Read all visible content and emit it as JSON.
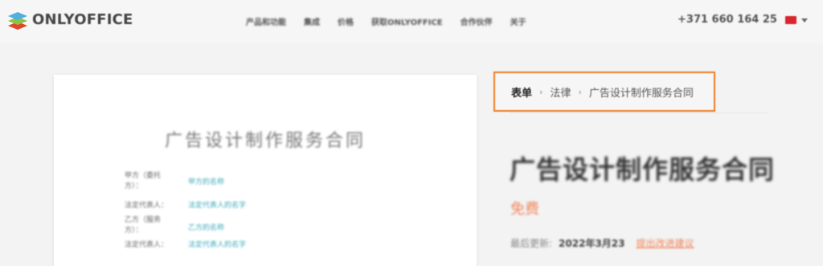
{
  "header": {
    "logo_text": "ONLYOFFICE",
    "nav": [
      "产品和功能",
      "集成",
      "价格",
      "获取ONLYOFFICE",
      "合作伙伴",
      "关于"
    ],
    "phone": "+371 660 164 25",
    "language_flag": "cn-flag-icon"
  },
  "preview": {
    "doc_title": "广告设计制作服务合同",
    "fields": [
      {
        "label": "甲方（委托方）：",
        "value": "甲方的名称"
      },
      {
        "label": "法定代表人：",
        "value": "法定代表人的名字"
      },
      {
        "label": "乙方（服务方）：",
        "value": "乙方的名称"
      },
      {
        "label": "法定代表人：",
        "value": "法定代表人的名字"
      }
    ]
  },
  "breadcrumb": {
    "items": [
      "表单",
      "法律",
      "广告设计制作服务合同"
    ],
    "separator": "›"
  },
  "form": {
    "title": "广告设计制作服务合同",
    "price": "免费",
    "updated_label": "最后更新:",
    "updated_date": "2022年3月23",
    "suggest_link": "提出改进建议"
  },
  "colors": {
    "accent_orange": "#f07a1f",
    "price_color": "#f0845a",
    "field_value_color": "#3aa9b8"
  }
}
